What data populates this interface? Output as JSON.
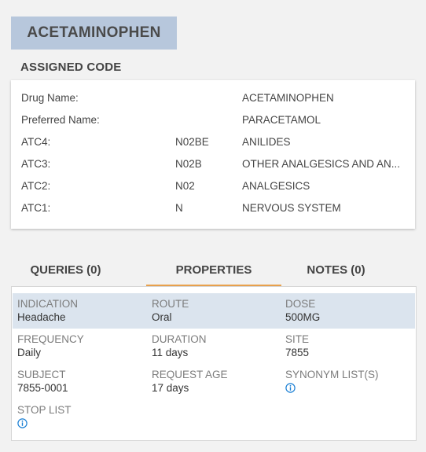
{
  "title": "ACETAMINOPHEN",
  "assigned_code": {
    "heading": "ASSIGNED CODE",
    "rows": [
      {
        "label": "Drug Name:",
        "code": "",
        "value": "ACETAMINOPHEN"
      },
      {
        "label": "Preferred Name:",
        "code": "",
        "value": "PARACETAMOL"
      },
      {
        "label": "ATC4:",
        "code": "N02BE",
        "value": "ANILIDES"
      },
      {
        "label": "ATC3:",
        "code": "N02B",
        "value": "OTHER ANALGESICS AND AN..."
      },
      {
        "label": "ATC2:",
        "code": "N02",
        "value": "ANALGESICS"
      },
      {
        "label": "ATC1:",
        "code": "N",
        "value": "NERVOUS SYSTEM"
      }
    ]
  },
  "tabs": [
    {
      "label": "QUERIES (0)",
      "active": false
    },
    {
      "label": "PROPERTIES",
      "active": true
    },
    {
      "label": "NOTES (0)",
      "active": false
    }
  ],
  "properties": {
    "indication": {
      "label": "INDICATION",
      "value": "Headache"
    },
    "route": {
      "label": "ROUTE",
      "value": "Oral"
    },
    "dose": {
      "label": "DOSE",
      "value": "500MG"
    },
    "frequency": {
      "label": "FREQUENCY",
      "value": "Daily"
    },
    "duration": {
      "label": "DURATION",
      "value": "11 days"
    },
    "site": {
      "label": "SITE",
      "value": "7855"
    },
    "subject": {
      "label": "SUBJECT",
      "value": "7855-0001"
    },
    "request_age": {
      "label": "REQUEST AGE",
      "value": "17 days"
    },
    "synonym_lists": {
      "label": "SYNONYM LIST(S)",
      "icon": "info-icon"
    },
    "stop_list": {
      "label": "STOP LIST",
      "icon": "info-icon"
    }
  },
  "colors": {
    "title_bg": "#b7c7dc",
    "active_tab_underline": "#e8a04c",
    "highlight_row": "#dbe4ee",
    "info_icon": "#1a7fd4"
  }
}
